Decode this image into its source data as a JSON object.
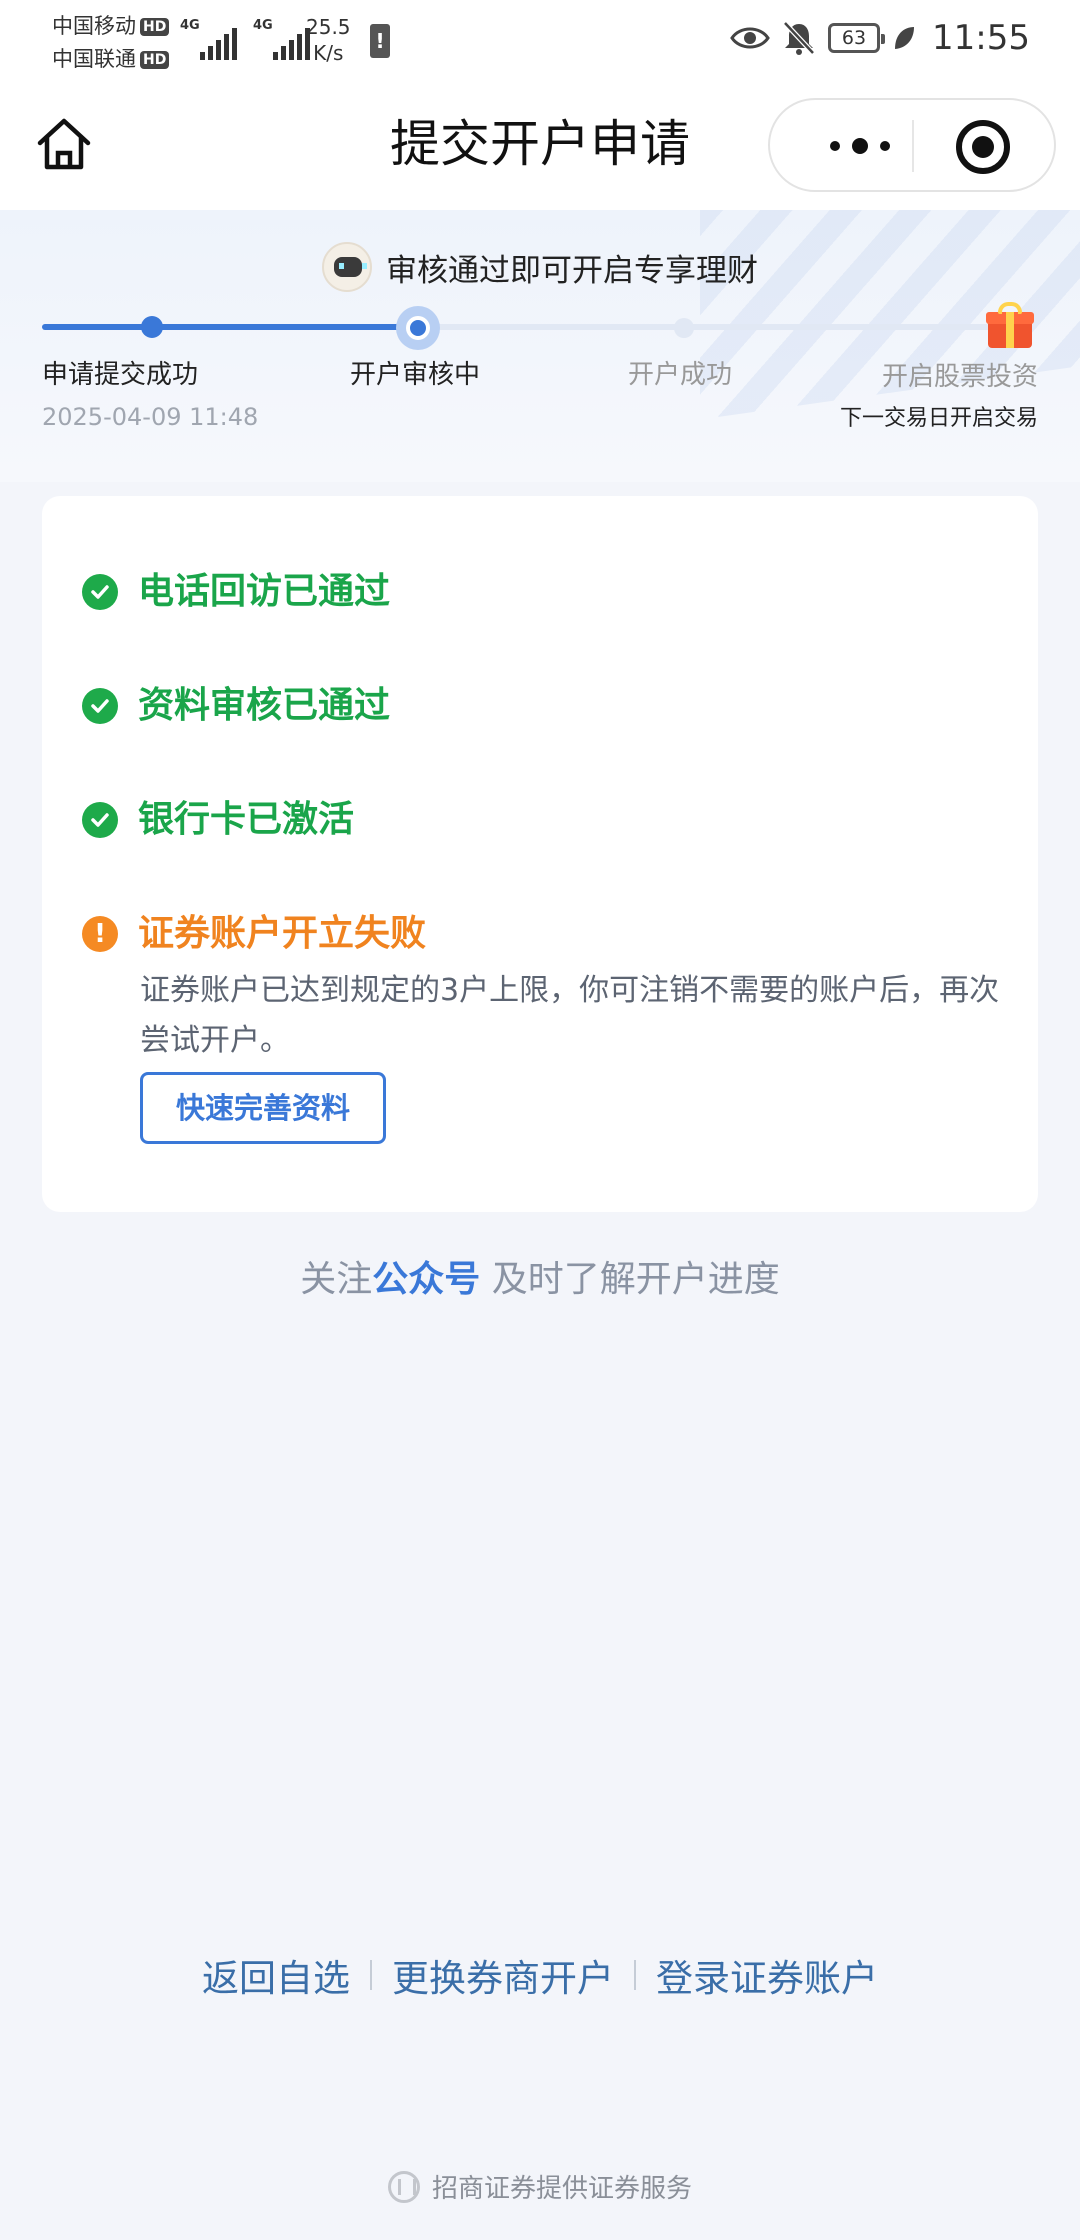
{
  "status_bar": {
    "carrier1": "中国移动",
    "carrier2": "中国联通",
    "hd": "HD",
    "net": "4G",
    "speed_value": "25.5",
    "speed_unit": "K/s",
    "battery": "63",
    "time": "11:55"
  },
  "nav": {
    "title": "提交开户申请"
  },
  "progress": {
    "promo": "审核通过即可开启专享理财",
    "steps": [
      "申请提交成功",
      "开户审核中",
      "开户成功",
      "开启股票投资"
    ],
    "step1_time": "2025-04-09 11:48",
    "next_trade": "下一交易日开启交易"
  },
  "card": {
    "items": [
      {
        "label": "电话回访已通过",
        "status": "ok"
      },
      {
        "label": "资料审核已通过",
        "status": "ok"
      },
      {
        "label": "银行卡已激活",
        "status": "ok"
      },
      {
        "label": "证券账户开立失败",
        "status": "fail"
      }
    ],
    "fail_icon": "!",
    "fail_desc": "证券账户已达到规定的3户上限，你可注销不需要的账户后，再次尝试开户。",
    "button": "快速完善资料"
  },
  "follow": {
    "prefix": "关注",
    "link": "公众号",
    "suffix": " 及时了解开户进度"
  },
  "bottom_links": [
    "返回自选",
    "更换券商开户",
    "登录证券账户"
  ],
  "footer": "招商证券提供证券服务",
  "colors": {
    "accent": "#3a78d8",
    "success": "#1aa54a",
    "warning": "#f0831f"
  }
}
